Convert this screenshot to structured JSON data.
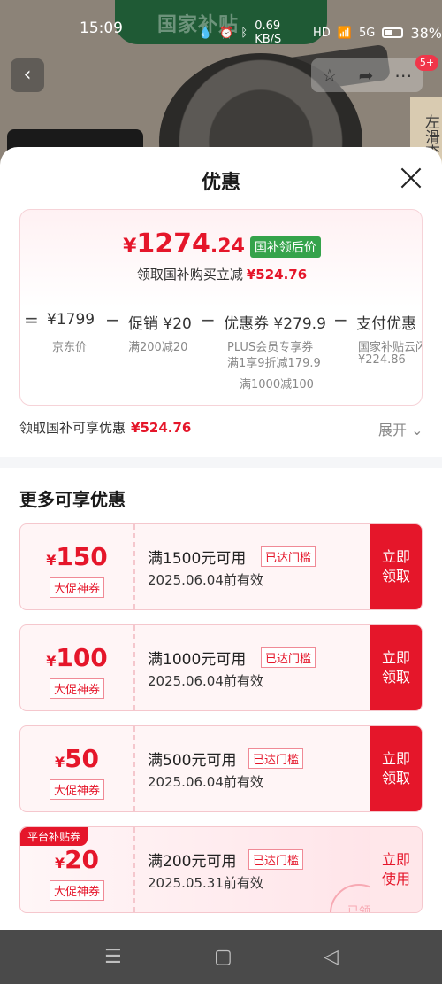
{
  "status_bar": {
    "time": "15:09",
    "net_speed": "0.69 KB/S",
    "hd": "HD",
    "signal": "5G",
    "battery": "38%"
  },
  "background": {
    "banner": "国家补贴",
    "back_icon": "chevron-left-icon",
    "star_icon": "star-icon",
    "share_icon": "share-icon",
    "more_icon": "more-icon",
    "badge": "5+",
    "slide_hint": "左滑查"
  },
  "sheet": {
    "title": "优惠",
    "final_price": {
      "currency": "¥",
      "integer": "1274",
      "decimal": ".24",
      "tag": "国补领后价"
    },
    "saving": {
      "label": "领取国补购买立减",
      "amount": "¥524.76"
    },
    "breakdown": {
      "eq": "=",
      "items": [
        {
          "label": "¥1799",
          "sub": "京东价"
        },
        {
          "op": "−",
          "label": "促销 ¥20",
          "sub": "满200减20"
        },
        {
          "op": "−",
          "label": "优惠券 ¥279.9",
          "sub": "PLUS会员专享券",
          "sub2": "满1享9折减179.9",
          "sub3": "满1000减100"
        },
        {
          "op": "−",
          "label": "支付优惠 ¥",
          "sub": "国家补贴云闪",
          "sub2": "¥224.86"
        }
      ]
    },
    "promo": {
      "label": "领取国补可享优惠",
      "amount": "¥524.76",
      "expand": "展开"
    },
    "section_title": "更多可享优惠",
    "coupons": [
      {
        "currency": "¥",
        "amount": "150",
        "tag": "大促神券",
        "condition": "满1500元可用",
        "status": "已达门槛",
        "validity": "2025.06.04前有效",
        "action": [
          "立即",
          "领取"
        ]
      },
      {
        "currency": "¥",
        "amount": "100",
        "tag": "大促神券",
        "condition": "满1000元可用",
        "status": "已达门槛",
        "validity": "2025.06.04前有效",
        "action": [
          "立即",
          "领取"
        ]
      },
      {
        "currency": "¥",
        "amount": "50",
        "tag": "大促神券",
        "condition": "满500元可用",
        "status": "已达门槛",
        "validity": "2025.06.04前有效",
        "action": [
          "立即",
          "领取"
        ]
      },
      {
        "corner": "平台补贴券",
        "currency": "¥",
        "amount": "20",
        "tag": "大促神券",
        "condition": "满200元可用",
        "status": "已达门槛",
        "validity": "2025.05.31前有效",
        "action": [
          "立即",
          "使用"
        ],
        "stamp": "已领"
      }
    ]
  },
  "nav": {
    "menu_icon": "☰",
    "home_icon": "▢",
    "back_icon": "◁"
  },
  "colors": {
    "accent_red": "#e5162a",
    "green_tag": "#35a34b"
  }
}
